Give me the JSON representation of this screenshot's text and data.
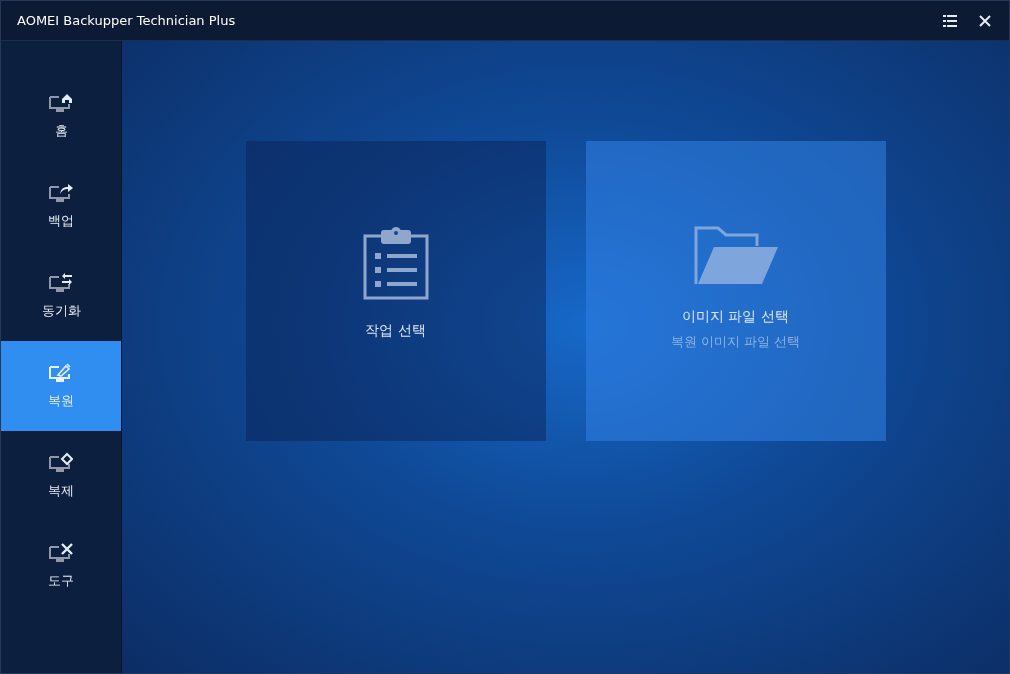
{
  "window": {
    "title": "AOMEI Backupper Technician Plus"
  },
  "sidebar": {
    "items": [
      {
        "label": "홈",
        "kind": "home",
        "selected": false
      },
      {
        "label": "백업",
        "kind": "backup",
        "selected": false
      },
      {
        "label": "동기화",
        "kind": "sync",
        "selected": false
      },
      {
        "label": "복원",
        "kind": "restore",
        "selected": true
      },
      {
        "label": "복제",
        "kind": "clone",
        "selected": false
      },
      {
        "label": "도구",
        "kind": "tools",
        "selected": false
      }
    ]
  },
  "options": [
    {
      "kind": "task",
      "title": "작업 선택",
      "selected": false
    },
    {
      "kind": "image",
      "title": "이미지 파일 선택",
      "subtitle": "복원 이미지 파일 선택",
      "selected": true
    }
  ]
}
